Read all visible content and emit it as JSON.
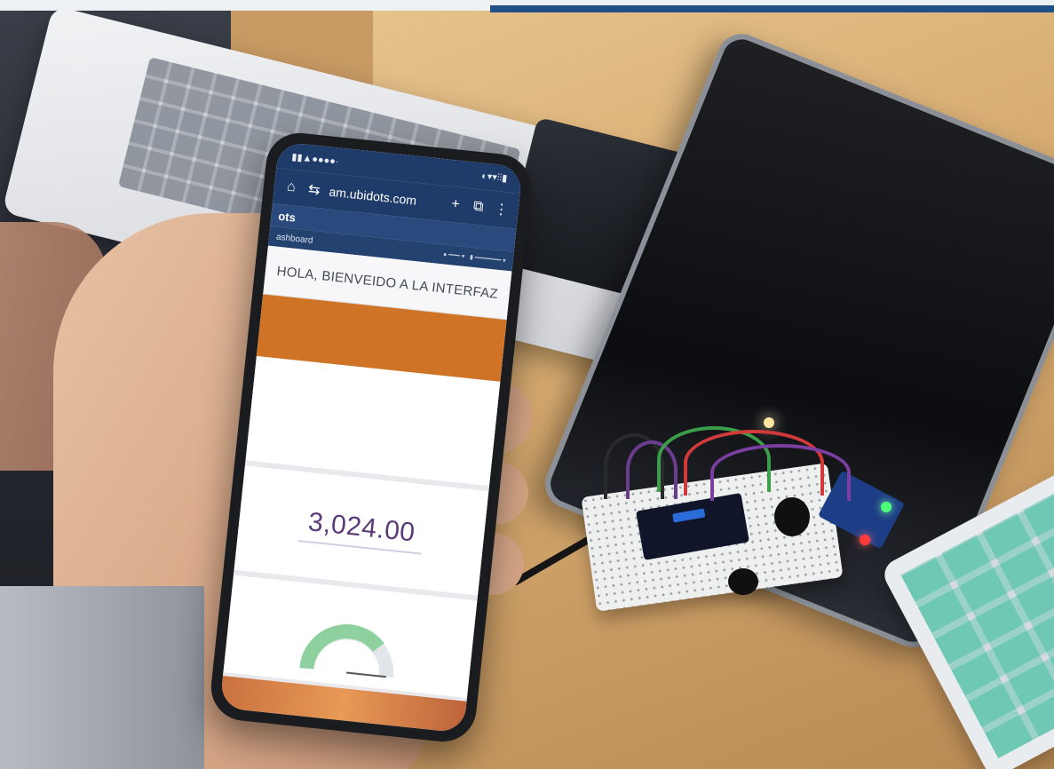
{
  "phone": {
    "url": "am.ubidots.com",
    "app_name": "ots",
    "dashboard_label": "ashboard",
    "welcome_text": "HOLA, BIENVEIDO A LA INTERFAZ",
    "metric_value": "3,024.00",
    "colors": {
      "header": "#1e3b69",
      "banner": "#cf7426",
      "metric_text": "#5a3a78",
      "gauge_fill": "#8fd19e"
    }
  }
}
